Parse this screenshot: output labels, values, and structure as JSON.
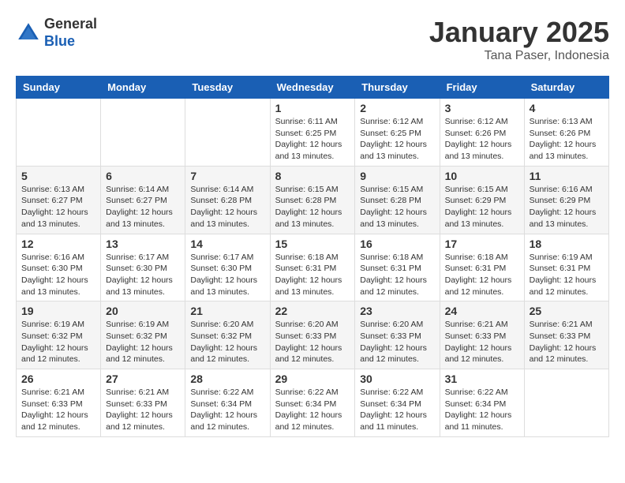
{
  "header": {
    "logo_general": "General",
    "logo_blue": "Blue",
    "month_title": "January 2025",
    "subtitle": "Tana Paser, Indonesia"
  },
  "days_of_week": [
    "Sunday",
    "Monday",
    "Tuesday",
    "Wednesday",
    "Thursday",
    "Friday",
    "Saturday"
  ],
  "weeks": [
    [
      {
        "day": "",
        "info": ""
      },
      {
        "day": "",
        "info": ""
      },
      {
        "day": "",
        "info": ""
      },
      {
        "day": "1",
        "info": "Sunrise: 6:11 AM\nSunset: 6:25 PM\nDaylight: 12 hours\nand 13 minutes."
      },
      {
        "day": "2",
        "info": "Sunrise: 6:12 AM\nSunset: 6:25 PM\nDaylight: 12 hours\nand 13 minutes."
      },
      {
        "day": "3",
        "info": "Sunrise: 6:12 AM\nSunset: 6:26 PM\nDaylight: 12 hours\nand 13 minutes."
      },
      {
        "day": "4",
        "info": "Sunrise: 6:13 AM\nSunset: 6:26 PM\nDaylight: 12 hours\nand 13 minutes."
      }
    ],
    [
      {
        "day": "5",
        "info": "Sunrise: 6:13 AM\nSunset: 6:27 PM\nDaylight: 12 hours\nand 13 minutes."
      },
      {
        "day": "6",
        "info": "Sunrise: 6:14 AM\nSunset: 6:27 PM\nDaylight: 12 hours\nand 13 minutes."
      },
      {
        "day": "7",
        "info": "Sunrise: 6:14 AM\nSunset: 6:28 PM\nDaylight: 12 hours\nand 13 minutes."
      },
      {
        "day": "8",
        "info": "Sunrise: 6:15 AM\nSunset: 6:28 PM\nDaylight: 12 hours\nand 13 minutes."
      },
      {
        "day": "9",
        "info": "Sunrise: 6:15 AM\nSunset: 6:28 PM\nDaylight: 12 hours\nand 13 minutes."
      },
      {
        "day": "10",
        "info": "Sunrise: 6:15 AM\nSunset: 6:29 PM\nDaylight: 12 hours\nand 13 minutes."
      },
      {
        "day": "11",
        "info": "Sunrise: 6:16 AM\nSunset: 6:29 PM\nDaylight: 12 hours\nand 13 minutes."
      }
    ],
    [
      {
        "day": "12",
        "info": "Sunrise: 6:16 AM\nSunset: 6:30 PM\nDaylight: 12 hours\nand 13 minutes."
      },
      {
        "day": "13",
        "info": "Sunrise: 6:17 AM\nSunset: 6:30 PM\nDaylight: 12 hours\nand 13 minutes."
      },
      {
        "day": "14",
        "info": "Sunrise: 6:17 AM\nSunset: 6:30 PM\nDaylight: 12 hours\nand 13 minutes."
      },
      {
        "day": "15",
        "info": "Sunrise: 6:18 AM\nSunset: 6:31 PM\nDaylight: 12 hours\nand 13 minutes."
      },
      {
        "day": "16",
        "info": "Sunrise: 6:18 AM\nSunset: 6:31 PM\nDaylight: 12 hours\nand 12 minutes."
      },
      {
        "day": "17",
        "info": "Sunrise: 6:18 AM\nSunset: 6:31 PM\nDaylight: 12 hours\nand 12 minutes."
      },
      {
        "day": "18",
        "info": "Sunrise: 6:19 AM\nSunset: 6:31 PM\nDaylight: 12 hours\nand 12 minutes."
      }
    ],
    [
      {
        "day": "19",
        "info": "Sunrise: 6:19 AM\nSunset: 6:32 PM\nDaylight: 12 hours\nand 12 minutes."
      },
      {
        "day": "20",
        "info": "Sunrise: 6:19 AM\nSunset: 6:32 PM\nDaylight: 12 hours\nand 12 minutes."
      },
      {
        "day": "21",
        "info": "Sunrise: 6:20 AM\nSunset: 6:32 PM\nDaylight: 12 hours\nand 12 minutes."
      },
      {
        "day": "22",
        "info": "Sunrise: 6:20 AM\nSunset: 6:33 PM\nDaylight: 12 hours\nand 12 minutes."
      },
      {
        "day": "23",
        "info": "Sunrise: 6:20 AM\nSunset: 6:33 PM\nDaylight: 12 hours\nand 12 minutes."
      },
      {
        "day": "24",
        "info": "Sunrise: 6:21 AM\nSunset: 6:33 PM\nDaylight: 12 hours\nand 12 minutes."
      },
      {
        "day": "25",
        "info": "Sunrise: 6:21 AM\nSunset: 6:33 PM\nDaylight: 12 hours\nand 12 minutes."
      }
    ],
    [
      {
        "day": "26",
        "info": "Sunrise: 6:21 AM\nSunset: 6:33 PM\nDaylight: 12 hours\nand 12 minutes."
      },
      {
        "day": "27",
        "info": "Sunrise: 6:21 AM\nSunset: 6:33 PM\nDaylight: 12 hours\nand 12 minutes."
      },
      {
        "day": "28",
        "info": "Sunrise: 6:22 AM\nSunset: 6:34 PM\nDaylight: 12 hours\nand 12 minutes."
      },
      {
        "day": "29",
        "info": "Sunrise: 6:22 AM\nSunset: 6:34 PM\nDaylight: 12 hours\nand 12 minutes."
      },
      {
        "day": "30",
        "info": "Sunrise: 6:22 AM\nSunset: 6:34 PM\nDaylight: 12 hours\nand 11 minutes."
      },
      {
        "day": "31",
        "info": "Sunrise: 6:22 AM\nSunset: 6:34 PM\nDaylight: 12 hours\nand 11 minutes."
      },
      {
        "day": "",
        "info": ""
      }
    ]
  ]
}
